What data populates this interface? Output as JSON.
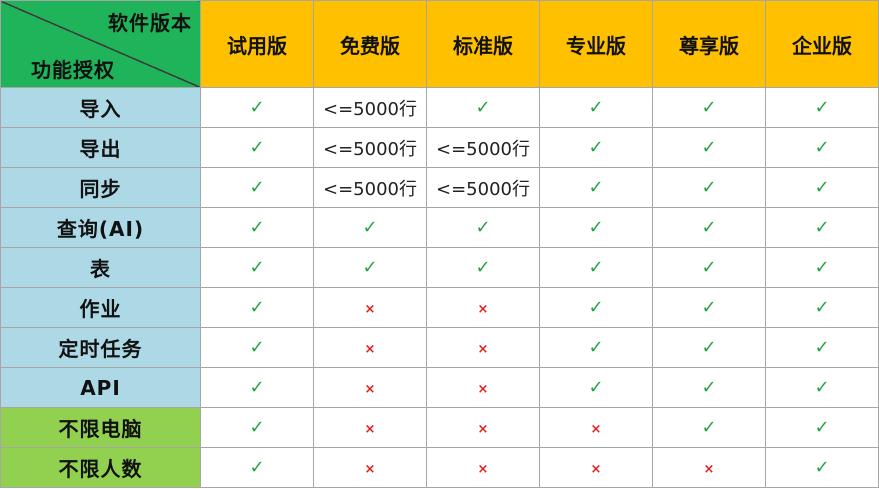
{
  "corner": {
    "version_header": "软件版本",
    "feature_header": "功能授权"
  },
  "versions": [
    "试用版",
    "免费版",
    "标准版",
    "专业版",
    "尊享版",
    "企业版"
  ],
  "rows": [
    {
      "feature": "导入",
      "group": "core",
      "cells": [
        "✓",
        "<=5000行",
        "✓",
        "✓",
        "✓",
        "✓"
      ]
    },
    {
      "feature": "导出",
      "group": "core",
      "cells": [
        "✓",
        "<=5000行",
        "<=5000行",
        "✓",
        "✓",
        "✓"
      ]
    },
    {
      "feature": "同步",
      "group": "core",
      "cells": [
        "✓",
        "<=5000行",
        "<=5000行",
        "✓",
        "✓",
        "✓"
      ]
    },
    {
      "feature": "查询(AI)",
      "group": "core",
      "cells": [
        "✓",
        "✓",
        "✓",
        "✓",
        "✓",
        "✓"
      ]
    },
    {
      "feature": "表",
      "group": "core",
      "cells": [
        "✓",
        "✓",
        "✓",
        "✓",
        "✓",
        "✓"
      ]
    },
    {
      "feature": "作业",
      "group": "core",
      "cells": [
        "✓",
        "×",
        "×",
        "✓",
        "✓",
        "✓"
      ]
    },
    {
      "feature": "定时任务",
      "group": "core",
      "cells": [
        "✓",
        "×",
        "×",
        "✓",
        "✓",
        "✓"
      ]
    },
    {
      "feature": "API",
      "group": "core",
      "cells": [
        "✓",
        "×",
        "×",
        "✓",
        "✓",
        "✓"
      ]
    },
    {
      "feature": "不限电脑",
      "group": "license",
      "cells": [
        "✓",
        "×",
        "×",
        "×",
        "✓",
        "✓"
      ]
    },
    {
      "feature": "不限人数",
      "group": "license",
      "cells": [
        "✓",
        "×",
        "×",
        "×",
        "×",
        "✓"
      ]
    }
  ],
  "colors": {
    "corner_bg": "#1fb35a",
    "version_header_bg": "#ffc000",
    "feature_core_bg": "#add8e6",
    "feature_license_bg": "#92d050",
    "check_color": "#25a244",
    "cross_color": "#e0201e"
  }
}
